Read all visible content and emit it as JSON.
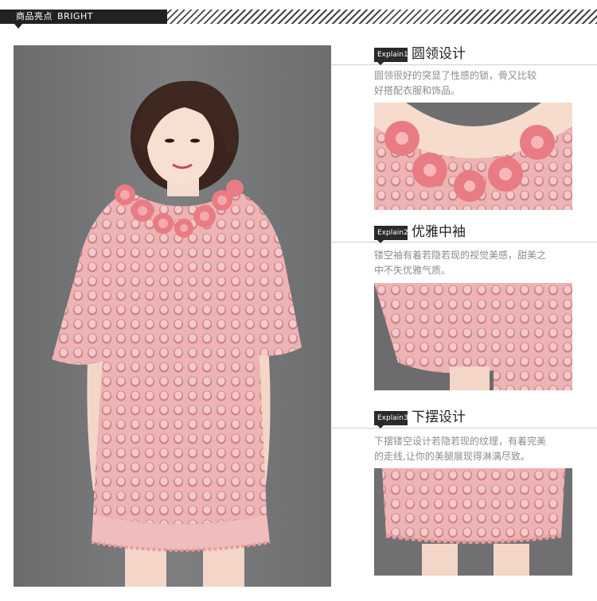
{
  "header": {
    "title_cn": "商品亮点",
    "title_en": "BRIGHT"
  },
  "sections": [
    {
      "badge": "Explain1",
      "title": "圆领设计",
      "desc_line1": "圆领很好的突显了性感的锁，骨又比较",
      "desc_line2": "好搭配衣服和饰品。"
    },
    {
      "badge": "Explain2",
      "title": "优雅中袖",
      "desc_line1": "镂空袖有着若隐若现的视觉美感，甜美之",
      "desc_line2": "中不失优雅气质。"
    },
    {
      "badge": "Explain3",
      "title": "下摆设计",
      "desc_line1": "下摆镂空设计若隐若现的纹理，有着完美",
      "desc_line2": "的走线,让你的美腿展现得淋漓尽致。"
    }
  ],
  "colors": {
    "dress_pink": "#e9a7a8",
    "dress_dark": "#c77d82",
    "backdrop": "#727476"
  }
}
